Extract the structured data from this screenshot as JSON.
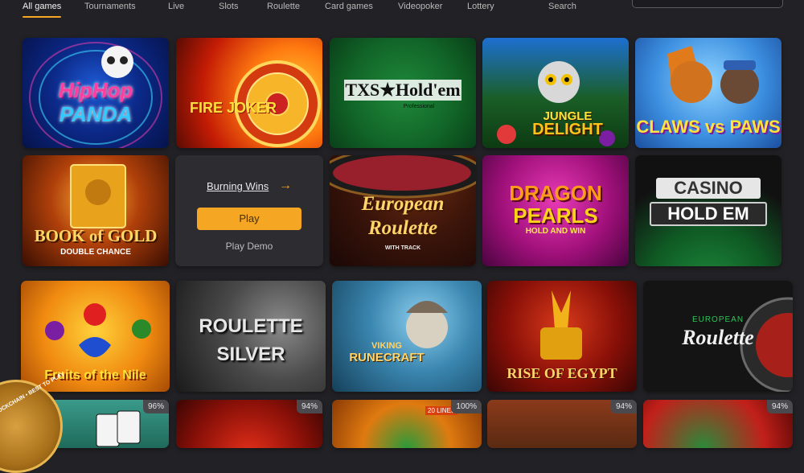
{
  "nav": {
    "tabs": [
      {
        "label": "All games",
        "active": true
      },
      {
        "label": "Tournaments"
      },
      {
        "label": "Live"
      },
      {
        "label": "Slots"
      },
      {
        "label": "Roulette"
      },
      {
        "label": "Card games"
      },
      {
        "label": "Videopoker"
      },
      {
        "label": "Lottery"
      }
    ],
    "search_label": "Search"
  },
  "games": {
    "hiphop_panda": {
      "line1": "HipHop",
      "line2": "PANDA"
    },
    "fire_joker": {
      "title": "FIRE JOKER"
    },
    "txs_holdem": {
      "title": "TXS★Hold'em",
      "subtitle": "Professional"
    },
    "jungle_delight": {
      "line1": "JUNGLE",
      "line2": "DELIGHT"
    },
    "claws_vs_paws": {
      "title": "CLAWS vs PAWS"
    },
    "book_of_gold": {
      "line1": "BOOK of GOLD",
      "line2": "DOUBLE CHANCE"
    },
    "burning_wins": {
      "link": "Burning Wins",
      "play": "Play",
      "demo": "Play Demo"
    },
    "european_roulette": {
      "line1": "European",
      "line2": "Roulette",
      "line3": "WITH TRACK"
    },
    "dragon_pearls": {
      "line1": "DRAGON",
      "line2": "PEARLS",
      "line3": "HOLD AND WIN"
    },
    "casino_holdem": {
      "line1": "CASINO",
      "line2": "HOLD EM"
    },
    "fruits_of_the_nile": {
      "title": "Fruits of the Nile"
    },
    "roulette_silver": {
      "line1": "ROULETTE",
      "line2": "SILVER"
    },
    "viking_runecraft": {
      "line1": "VIKING",
      "line2": "RUNECRAFT"
    },
    "rise_of_egypt": {
      "title": "RISE OF EGYPT"
    },
    "european_roulette_2": {
      "line1": "EUROPEAN",
      "line2": "Roulette"
    }
  },
  "bottom_row": {
    "badges": [
      "96%",
      "94%",
      "100%",
      "94%",
      "94%"
    ],
    "lines_label": "20 LINES"
  },
  "promo_badge": {
    "text": "BLOCKCHAIN • BEST TO PLAY"
  }
}
